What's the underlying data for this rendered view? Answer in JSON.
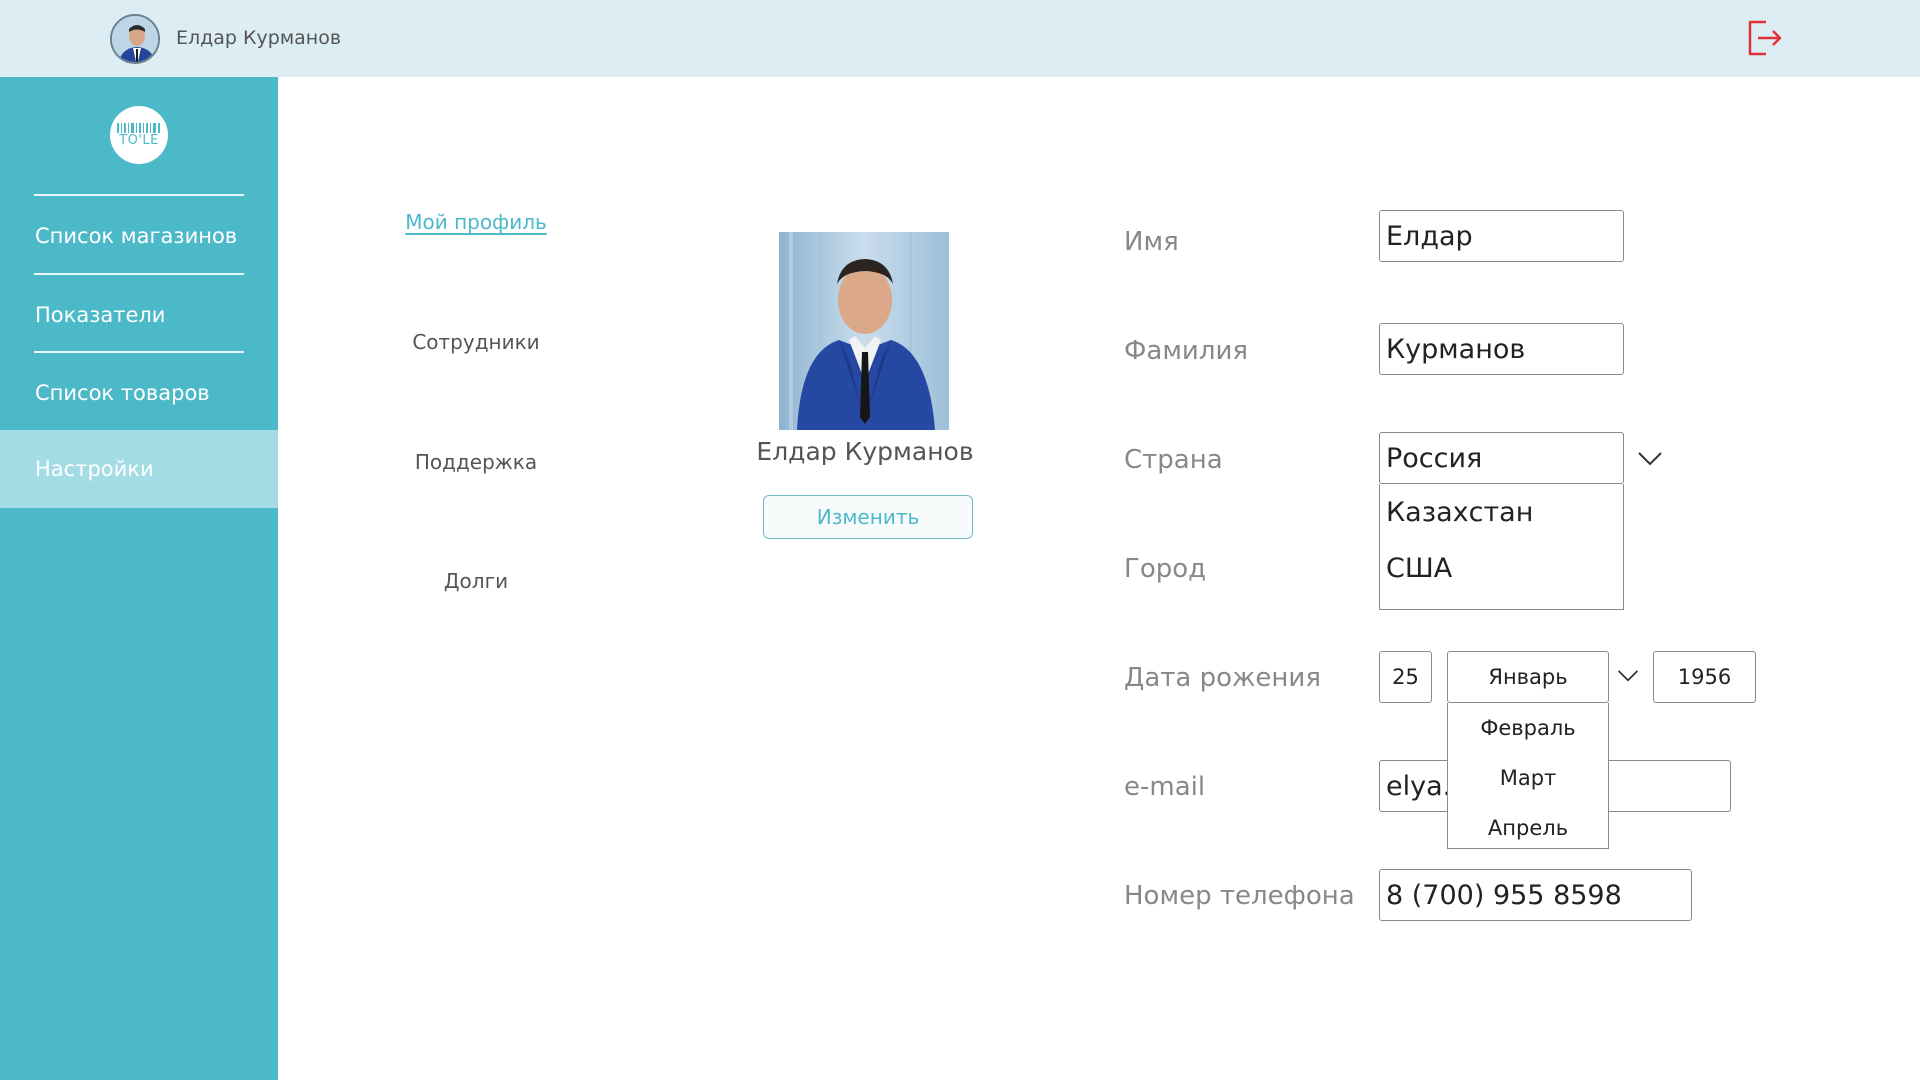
{
  "header": {
    "user_name": "Елдар Курманов"
  },
  "sidebar": {
    "logo_text": "TO'LE",
    "items": [
      {
        "label": "Список магазинов"
      },
      {
        "label": "Показатели"
      },
      {
        "label": "Список товаров"
      },
      {
        "label": "Настройки",
        "active": true
      }
    ]
  },
  "submenu": {
    "items": [
      {
        "label": "Мой профиль",
        "active": true
      },
      {
        "label": "Сотрудники"
      },
      {
        "label": "Поддержка"
      },
      {
        "label": "Долги"
      }
    ]
  },
  "profile": {
    "name": "Елдар Курманов",
    "change_label": "Изменить"
  },
  "form": {
    "first_name": {
      "label": "Имя",
      "value": "Елдар"
    },
    "last_name": {
      "label": "Фамилия",
      "value": "Курманов"
    },
    "country": {
      "label": "Страна",
      "value": "Россия",
      "options": [
        "Казахстан",
        "США"
      ]
    },
    "city": {
      "label": "Город"
    },
    "birth_date": {
      "label": "Дата рожения",
      "day": "25",
      "month": "Январь",
      "month_options": [
        "Февраль",
        "Март",
        "Апрель"
      ],
      "year": "1956"
    },
    "email": {
      "label": "e-mail",
      "value_left": "elya.b",
      "value_right": "m"
    },
    "phone": {
      "label": "Номер телефона",
      "value": "8 (700) 955 8598"
    }
  },
  "colors": {
    "accent": "#4cb9c9",
    "sidebar_active": "#a3dce5",
    "header_bg": "#dceef3",
    "logout": "#e0323a"
  }
}
